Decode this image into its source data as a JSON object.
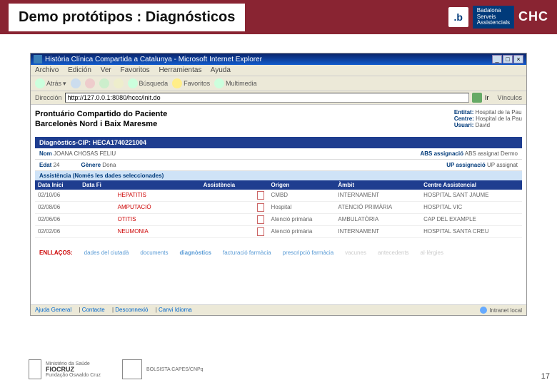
{
  "slide": {
    "title": "Demo protótipos : Diagnósticos",
    "logo_b": ".b",
    "logo_bsa_line1": "Badalona",
    "logo_bsa_line2": "Serveis",
    "logo_bsa_line3": "Assistencials",
    "logo_chc": "CHC"
  },
  "ie": {
    "title": "Història Clínica Compartida a Catalunya - Microsoft Internet Explorer",
    "menu": [
      "Archivo",
      "Edición",
      "Ver",
      "Favoritos",
      "Herramientas",
      "Ayuda"
    ],
    "toolbar": {
      "back": "Atrás",
      "search": "Búsqueda",
      "fav": "Favoritos",
      "media": "Multimedia"
    },
    "address_label": "Dirección",
    "address_value": "http://127.0.0.1:8080/hccc/init.do",
    "go": "Ir",
    "links": "Vínculos",
    "footer_left": [
      "Ajuda General",
      "Contacte",
      "Desconnexió",
      "Canvi Idioma"
    ],
    "footer_right": "Intranet local"
  },
  "page": {
    "header_line1": "Prontuário Compartido do Paciente",
    "header_line2": "Barcelonès Nord i Baix Maresme",
    "meta": {
      "entitat_lbl": "Entitat:",
      "entitat_val": "Hospital de la Pau",
      "centre_lbl": "Centre:",
      "centre_val": "Hospital de la Pau",
      "usuari_lbl": "Usuari:",
      "usuari_val": "David"
    },
    "diag_bar": "Diagnòstics-CIP: HECA1740221004",
    "patient": {
      "nom_lbl": "Nom",
      "nom_val": "JOANA CHOSAS FELIU",
      "edat_lbl": "Edat",
      "edat_val": "24",
      "genere_lbl": "Gènere",
      "genere_val": "Dona",
      "abs_lbl": "ABS assignació",
      "abs_val": "ABS assignat Dermo",
      "up_lbl": "UP assignació",
      "up_val": "UP assignat"
    },
    "assist_bar": "Assistència (Només les dades seleccionades)",
    "table": {
      "headers": [
        "Data Inici",
        "Data Fi",
        "",
        "Assistència",
        "",
        "Origen",
        "Àmbit",
        "Centre Assistencial"
      ],
      "rows": [
        {
          "di": "02/10/06",
          "df": "",
          "diag": "HEPATITIS",
          "origen": "CMBD",
          "ambit": "INTERNAMENT",
          "centre": "HOSPITAL SANT JAUME"
        },
        {
          "di": "02/08/06",
          "df": "",
          "diag": "AMPUTACIÓ",
          "origen": "Hospital",
          "ambit": "ATENCIÓ PRIMÀRIA",
          "centre": "HOSPITAL VIC"
        },
        {
          "di": "02/06/06",
          "df": "",
          "diag": "OTITIS",
          "origen": "Atenció primària",
          "ambit": "AMBULATÒRIA",
          "centre": "CAP DEL EXAMPLE"
        },
        {
          "di": "02/02/06",
          "df": "",
          "diag": "NEUMONIA",
          "origen": "Atenció primària",
          "ambit": "INTERNAMENT",
          "centre": "HOSPITAL SANTA CREU"
        }
      ]
    },
    "links": {
      "label": "ENLLAÇOS:",
      "items": [
        "dades del ciutadà",
        "documents",
        "diagnòstics",
        "facturació farmàcia",
        "prescripció farmàcia",
        "vacunes",
        "antecedents",
        "al·lèrgies"
      ]
    }
  },
  "footer": {
    "fiocruz_line1": "Ministério da Saúde",
    "fiocruz_line2": "FIOCRUZ",
    "fiocruz_line3": "Fundação Oswaldo Cruz",
    "bolsa": "BOLSISTA CAPES/CNPq"
  },
  "page_num": "17"
}
